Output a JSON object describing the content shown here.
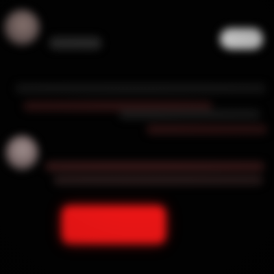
{
  "screen": {
    "background_color": "#030303",
    "accent_color": "#ff1717",
    "blurred": true
  },
  "header": {
    "avatar_icon": "user-avatar",
    "username": "",
    "follow_label": ""
  },
  "post": {
    "lines": [
      "",
      "",
      "",
      ""
    ]
  },
  "reply": {
    "avatar_icon": "user-avatar",
    "lines": [
      "",
      ""
    ]
  },
  "actions": {
    "primary_label": ""
  }
}
